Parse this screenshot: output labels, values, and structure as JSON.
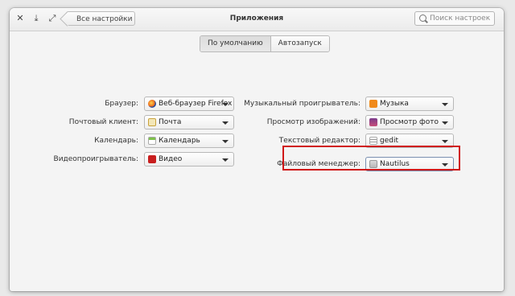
{
  "window": {
    "title": "Приложения",
    "back_label": "Все настройки",
    "search_placeholder": "Поиск настроек"
  },
  "tabs": [
    {
      "label": "По умолчанию",
      "active": true
    },
    {
      "label": "Автозапуск",
      "active": false
    }
  ],
  "left_settings": [
    {
      "label": "Браузер:",
      "value": "Веб-браузер Firefox",
      "icon": "firefox-icon"
    },
    {
      "label": "Почтовый клиент:",
      "value": "Почта",
      "icon": "mail-icon"
    },
    {
      "label": "Календарь:",
      "value": "Календарь",
      "icon": "calendar-icon"
    },
    {
      "label": "Видеопроигрыватель:",
      "value": "Видео",
      "icon": "video-icon"
    }
  ],
  "right_settings": [
    {
      "label": "Музыкальный проигрыватель:",
      "value": "Музыка",
      "icon": "music-icon"
    },
    {
      "label": "Просмотр изображений:",
      "value": "Просмотр фото",
      "icon": "photo-icon"
    },
    {
      "label": "Текстовый редактор:",
      "value": "gedit",
      "icon": "text-editor-icon"
    },
    {
      "label": "Файловый менеджер:",
      "value": "Nautilus",
      "icon": "folder-icon"
    }
  ],
  "colors": {
    "highlight": "#d01818"
  }
}
